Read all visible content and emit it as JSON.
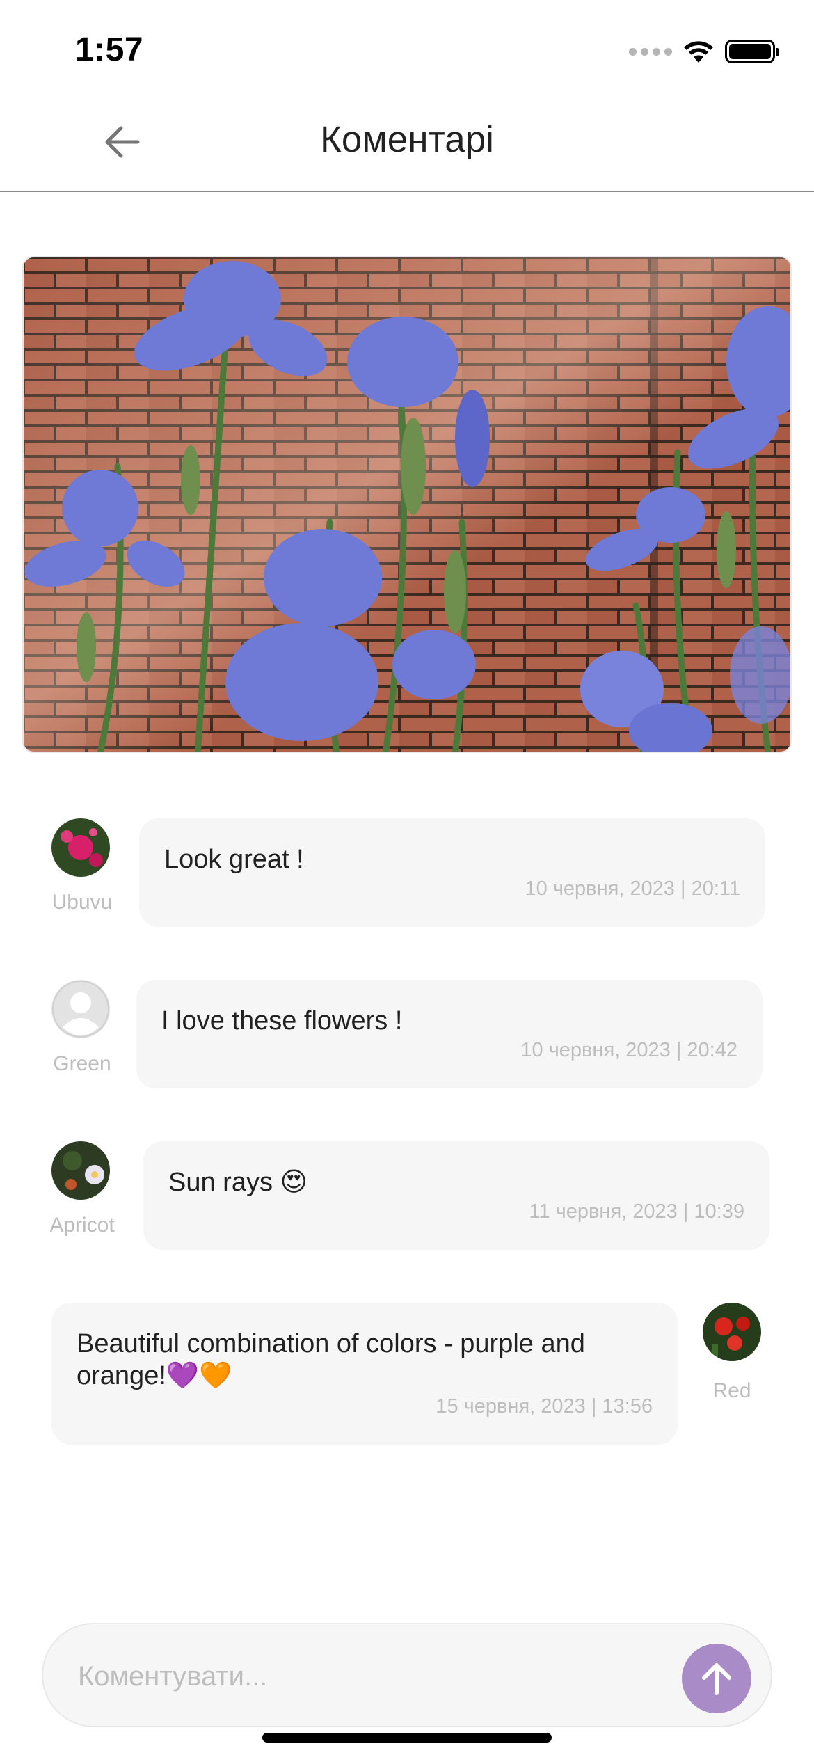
{
  "status_bar": {
    "time": "1:57"
  },
  "header": {
    "title": "Коментарі"
  },
  "comments": [
    {
      "author": "Ubuvu",
      "text": "Look great !",
      "date": "10 червня, 2023 | 20:11"
    },
    {
      "author": "Green",
      "text": "I love these flowers !",
      "date": "10 червня, 2023 | 20:42"
    },
    {
      "author": "Apricot",
      "text": "Sun rays 😍",
      "date": "11 червня, 2023 | 10:39"
    },
    {
      "author": "Red",
      "text": "Beautiful combination of colors - purple and orange!💜🧡",
      "date": "15 червня, 2023 | 13:56"
    }
  ],
  "composer": {
    "placeholder": "Коментувати..."
  },
  "colors": {
    "accent": "#a98cc7",
    "bubble": "#f6f6f6",
    "muted_text": "#bdbdbd"
  }
}
